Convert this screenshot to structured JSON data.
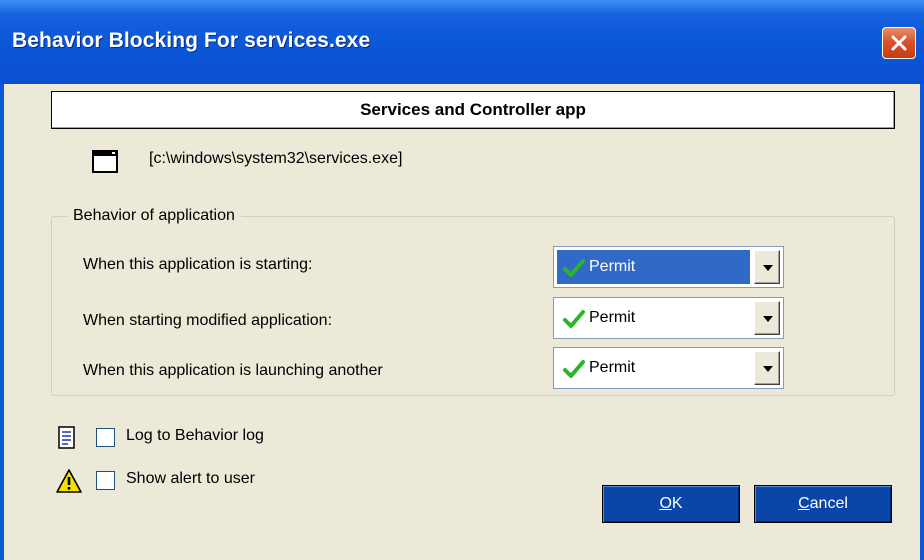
{
  "window": {
    "title": "Behavior Blocking For services.exe",
    "close_icon": "close-x-icon"
  },
  "header": {
    "app_name": "Services and Controller app",
    "app_path": "[c:\\windows\\system32\\services.exe]",
    "app_icon": "application-window-icon"
  },
  "behavior_group": {
    "legend": "Behavior of application",
    "rows": [
      {
        "label": "When this application is starting:",
        "value": "Permit",
        "icon": "green-check-icon",
        "focused": true
      },
      {
        "label": "When starting modified application:",
        "value": "Permit",
        "icon": "green-check-icon",
        "focused": false
      },
      {
        "label": "When this application is launching another",
        "value": "Permit",
        "icon": "green-check-icon",
        "focused": false
      }
    ]
  },
  "options": {
    "log": {
      "label": "Log to Behavior log",
      "checked": false,
      "icon": "log-document-icon"
    },
    "alert": {
      "label": "Show alert to user",
      "checked": false,
      "icon": "warning-icon"
    }
  },
  "buttons": {
    "ok": {
      "mnemonic": "O",
      "rest": "K"
    },
    "cancel": {
      "mnemonic": "C",
      "rest": "ancel"
    }
  },
  "colors": {
    "titlebar": "#0a57d8",
    "dialog_bg": "#ece9d8",
    "button_bg": "#0a46a8",
    "selection": "#3169c6",
    "check": "#2bb52b"
  }
}
